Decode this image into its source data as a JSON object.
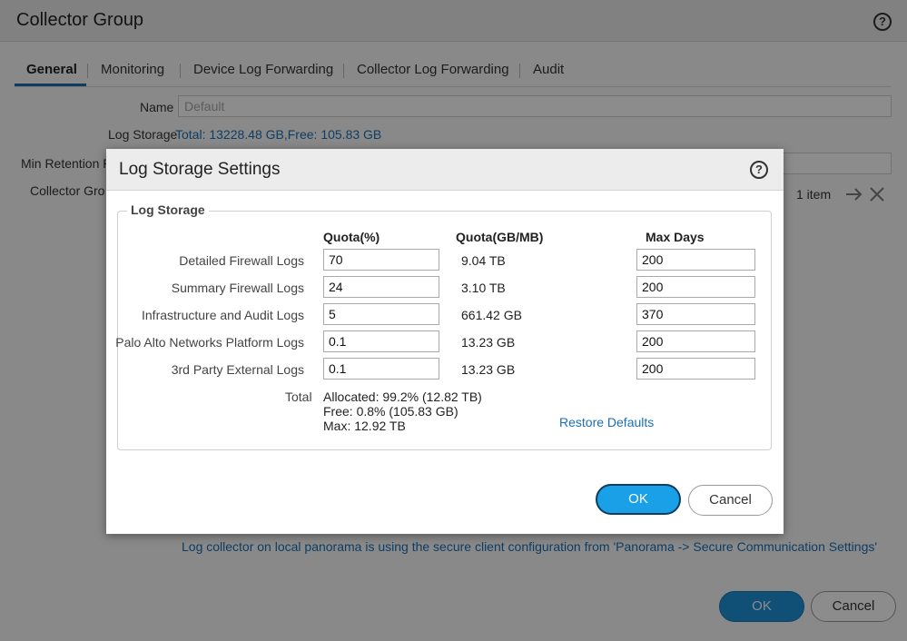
{
  "background": {
    "title": "Collector Group",
    "tabs": [
      "General",
      "Monitoring",
      "Device Log Forwarding",
      "Collector Log Forwarding",
      "Audit"
    ],
    "name_label": "Name",
    "name_placeholder": "Default",
    "log_storage_label": "Log Storage",
    "log_storage_value": "Total: 13228.48 GB,Free: 105.83 GB",
    "min_retention_label": "Min Retention P",
    "collector_group_label": "Collector Gro",
    "item_count": "1 item",
    "secure_note": "Log collector on local panorama is using the secure client configuration from 'Panorama -> Secure Communication Settings'",
    "ok_label": "OK",
    "cancel_label": "Cancel"
  },
  "modal": {
    "title": "Log Storage Settings",
    "legend": "Log Storage",
    "col_quota_pct": "Quota(%)",
    "col_quota_size": "Quota(GB/MB)",
    "col_max_days": "Max Days",
    "rows": [
      {
        "label": "Detailed Firewall Logs",
        "quota": "70",
        "size": "9.04 TB",
        "days": "200"
      },
      {
        "label": "Summary Firewall Logs",
        "quota": "24",
        "size": "3.10 TB",
        "days": "200"
      },
      {
        "label": "Infrastructure and Audit Logs",
        "quota": "5",
        "size": "661.42 GB",
        "days": "370"
      },
      {
        "label": "Palo Alto Networks Platform Logs",
        "quota": "0.1",
        "size": "13.23 GB",
        "days": "200"
      },
      {
        "label": "3rd Party External Logs",
        "quota": "0.1",
        "size": "13.23 GB",
        "days": "200"
      }
    ],
    "total_label": "Total",
    "total_allocated": "Allocated: 99.2% (12.82 TB)",
    "total_free": "Free: 0.8% (105.83 GB)",
    "total_max": "Max: 12.92 TB",
    "restore_defaults": "Restore Defaults",
    "ok_label": "OK",
    "cancel_label": "Cancel"
  },
  "colors": {
    "accent": "#1a6fb6",
    "ok_button": "#1aa0e6"
  },
  "icons": {
    "help": "help-circle-icon",
    "arrow": "arrow-right-icon",
    "close": "close-x-icon"
  }
}
